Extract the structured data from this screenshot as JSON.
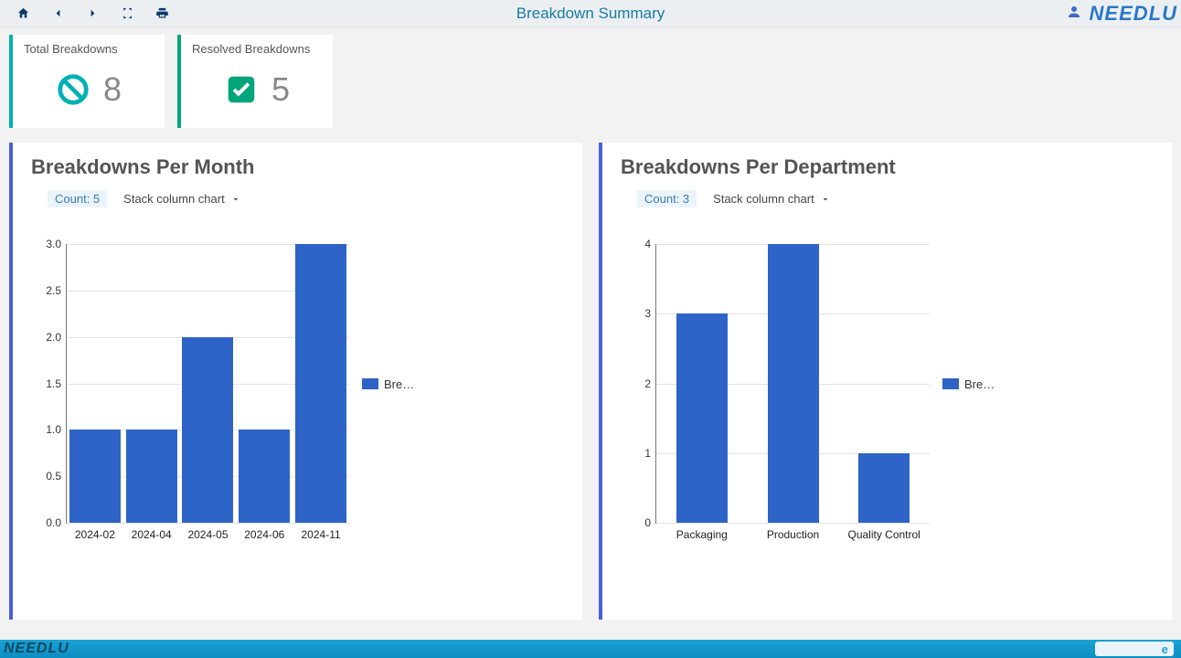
{
  "header": {
    "title": "Breakdown Summary",
    "brand": "NEEDLU"
  },
  "kpis": {
    "total": {
      "label": "Total Breakdowns",
      "value": "8"
    },
    "resolved": {
      "label": "Resolved Breakdowns",
      "value": "5"
    }
  },
  "panels": {
    "month": {
      "title": "Breakdowns Per Month",
      "count_label": "Count: 5",
      "chart_type_label": "Stack column chart",
      "legend": "Bre…"
    },
    "dept": {
      "title": "Breakdowns Per Department",
      "count_label": "Count: 3",
      "chart_type_label": "Stack column chart",
      "legend": "Bre…"
    }
  },
  "chart_data": [
    {
      "type": "bar",
      "title": "Breakdowns Per Month",
      "categories": [
        "2024-02",
        "2024-04",
        "2024-05",
        "2024-06",
        "2024-11"
      ],
      "series": [
        {
          "name": "Bre…",
          "values": [
            1,
            1,
            2,
            1,
            3
          ]
        }
      ],
      "yticks": [
        "0.0",
        "0.5",
        "1.0",
        "1.5",
        "2.0",
        "2.5",
        "3.0"
      ],
      "ylim": [
        0,
        3
      ]
    },
    {
      "type": "bar",
      "title": "Breakdowns Per Department",
      "categories": [
        "Packaging",
        "Production",
        "Quality Control"
      ],
      "series": [
        {
          "name": "Bre…",
          "values": [
            3,
            4,
            1
          ]
        }
      ],
      "yticks": [
        "0",
        "1",
        "2",
        "3",
        "4"
      ],
      "ylim": [
        0,
        4
      ]
    }
  ],
  "footer": {
    "brand": "NEEDLU"
  }
}
